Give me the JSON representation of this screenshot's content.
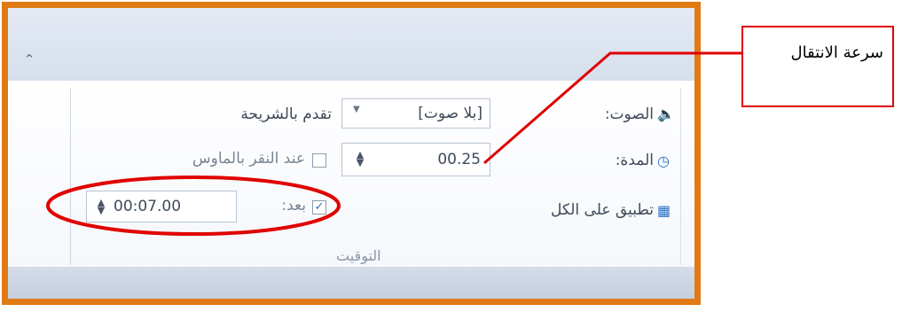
{
  "ribbon": {
    "sound_label": "الصوت:",
    "sound_value": "[بلا صوت]",
    "duration_label": "المدة:",
    "duration_value": "00.25",
    "apply_all_label": "تطبيق على الكل",
    "advance_title": "تقدم بالشريحة",
    "on_click_label": "عند النقر بالماوس",
    "on_click_checked": false,
    "after_label": "بعد:",
    "after_checked": true,
    "after_value": "00:07.00",
    "group_label": "التوقيت"
  },
  "callout": {
    "text": "سرعة الانتقال"
  },
  "colors": {
    "frame": "#e07a14",
    "annotation": "#e00000"
  }
}
